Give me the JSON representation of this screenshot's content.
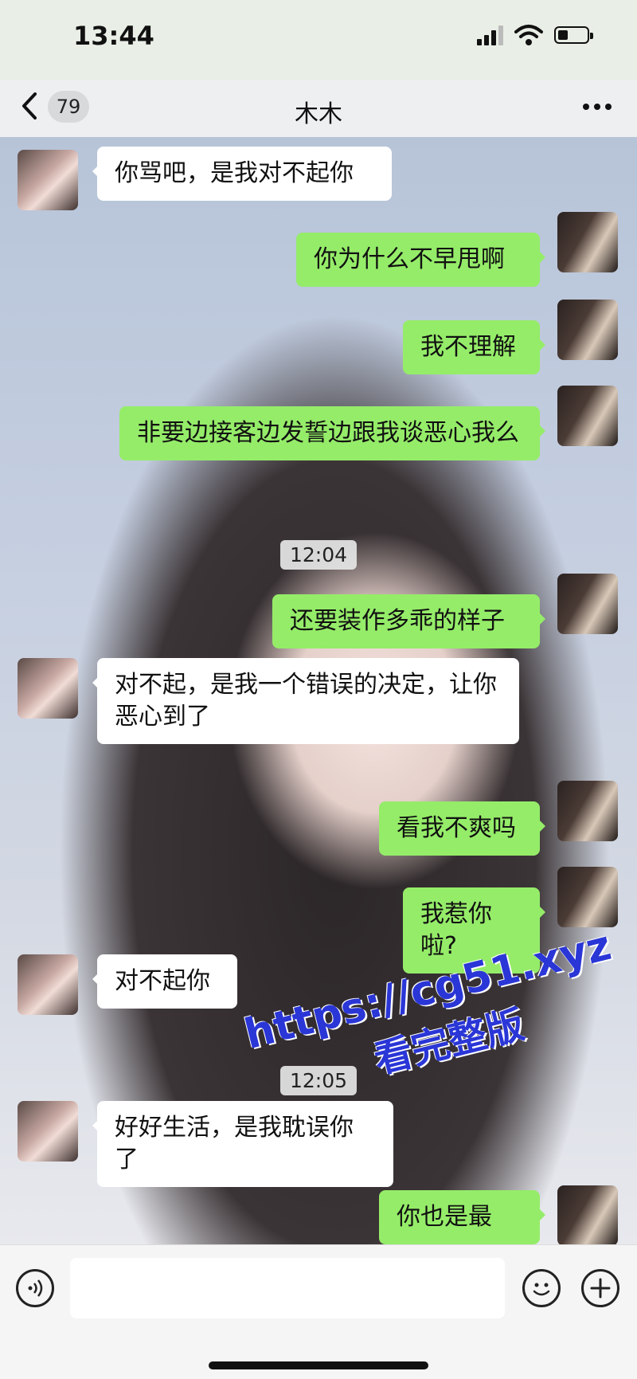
{
  "status_bar": {
    "time": "13:44",
    "battery_level": 0.35
  },
  "nav": {
    "unread_count": "79",
    "title": "木木"
  },
  "messages": [
    {
      "side": "left",
      "text": "你骂吧，是我对不起你"
    },
    {
      "side": "right",
      "text": "你为什么不早甩啊"
    },
    {
      "side": "right",
      "text": "我不理解"
    },
    {
      "side": "right",
      "text": "非要边接客边发誓边跟我谈恶心我么"
    },
    {
      "side": "time",
      "text": "12:04"
    },
    {
      "side": "right",
      "text": "还要装作多乖的样子"
    },
    {
      "side": "left",
      "text": "对不起，是我一个错误的决定，让你恶心到了"
    },
    {
      "side": "right",
      "text": "看我不爽吗"
    },
    {
      "side": "right",
      "text": "我惹你啦?"
    },
    {
      "side": "left",
      "text": "对不起你"
    },
    {
      "side": "time",
      "text": "12:05"
    },
    {
      "side": "left",
      "text": "好好生活，是我耽误你了"
    },
    {
      "side": "right",
      "text": "你也是最"
    }
  ],
  "watermark": {
    "url": "https://cg51.xyz",
    "subtitle": "看完整版"
  },
  "input": {
    "value": ""
  }
}
